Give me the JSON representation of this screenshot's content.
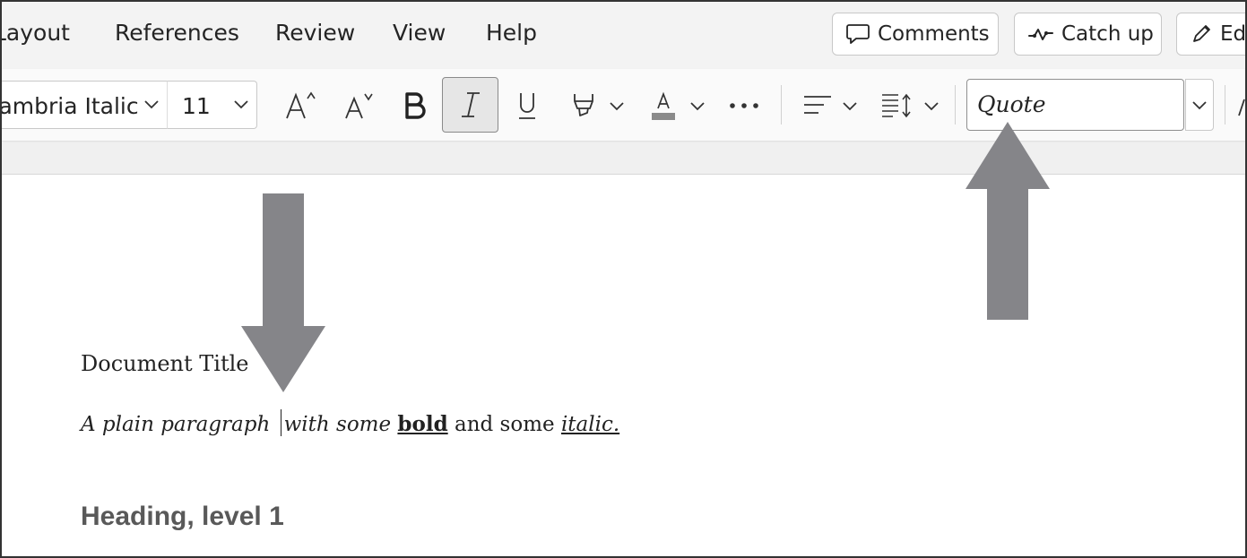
{
  "menu": {
    "tabs": [
      "Layout",
      "References",
      "Review",
      "View",
      "Help"
    ],
    "buttons": {
      "comments": "Comments",
      "catch_up": "Catch up",
      "editing": "Editing"
    }
  },
  "ribbon": {
    "font_name": "Cambria Italic",
    "font_size": "11",
    "style_selected": "Quote",
    "italic_active": true,
    "tools": [
      "grow-font",
      "shrink-font",
      "bold",
      "italic",
      "underline",
      "highlight",
      "font-color",
      "more",
      "align",
      "line-spacing"
    ]
  },
  "document": {
    "title": "Document Title",
    "paragraph": {
      "part1": "A plain paragraph ",
      "part2": "with some ",
      "bold": "bold",
      "part3": " and some ",
      "italic": "italic."
    },
    "heading1": "Heading, level 1"
  },
  "annotations": {
    "arrow_color": "#858589",
    "arrows": [
      "down-arrow-pointing-at-cursor",
      "up-arrow-pointing-at-style-box"
    ]
  },
  "colors": {
    "menubar_bg": "#f3f3f3",
    "ribbon_bg": "#fafafa",
    "heading_color": "#595959"
  }
}
